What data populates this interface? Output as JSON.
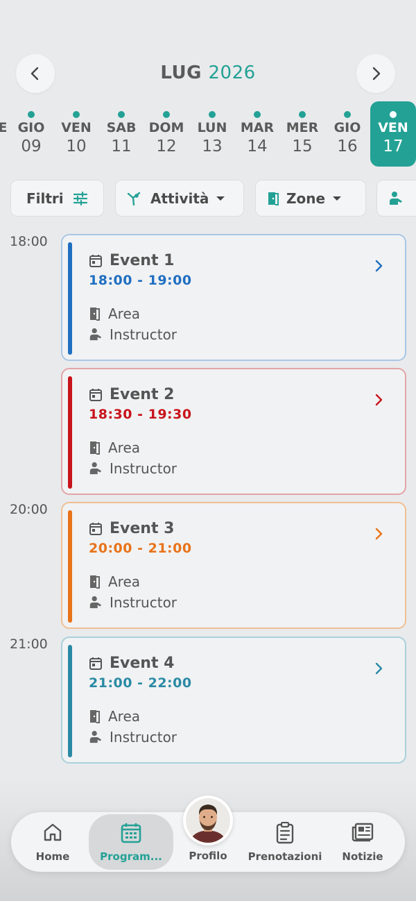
{
  "header": {
    "month": "LUG",
    "year": "2026",
    "prev_icon": "chevron-left-icon",
    "next_icon": "chevron-right-icon"
  },
  "days": [
    {
      "name": "GIO",
      "date": "09",
      "has_events": true,
      "selected": false
    },
    {
      "name": "VEN",
      "date": "10",
      "has_events": true,
      "selected": false
    },
    {
      "name": "SAB",
      "date": "11",
      "has_events": true,
      "selected": false
    },
    {
      "name": "DOM",
      "date": "12",
      "has_events": true,
      "selected": false
    },
    {
      "name": "LUN",
      "date": "13",
      "has_events": true,
      "selected": false
    },
    {
      "name": "MAR",
      "date": "14",
      "has_events": true,
      "selected": false
    },
    {
      "name": "MER",
      "date": "15",
      "has_events": true,
      "selected": false
    },
    {
      "name": "GIO",
      "date": "16",
      "has_events": true,
      "selected": false
    },
    {
      "name": "VEN",
      "date": "17",
      "has_events": true,
      "selected": true
    }
  ],
  "filters": {
    "filtri": "Filtri",
    "attivita": "Attività",
    "zone": "Zone"
  },
  "times": {
    "t1": "18:00",
    "t2": "20:00",
    "t3": "21:00"
  },
  "events": [
    {
      "title": "Event 1",
      "time": "18:00 - 19:00",
      "area": "Area",
      "instructor": "Instructor",
      "color": "#1f6fc1",
      "border": "#a9c7e6"
    },
    {
      "title": "Event 2",
      "time": "18:30 - 19:30",
      "area": "Area",
      "instructor": "Instructor",
      "color": "#c8141c",
      "border": "#e2a4a6"
    },
    {
      "title": "Event 3",
      "time": "20:00 - 21:00",
      "area": "Area",
      "instructor": "Instructor",
      "color": "#e8731a",
      "border": "#f0bf94"
    },
    {
      "title": "Event 4",
      "time": "21:00 - 22:00",
      "area": "Area",
      "instructor": "Instructor",
      "color": "#2a8aa5",
      "border": "#a9d0db"
    }
  ],
  "bottom_nav": {
    "home": "Home",
    "programma": "Program...",
    "profilo": "Profilo",
    "prenotazioni": "Prenotazioni",
    "notizie": "Notizie"
  },
  "colors": {
    "accent": "#23a195",
    "background": "#e9eaec"
  }
}
